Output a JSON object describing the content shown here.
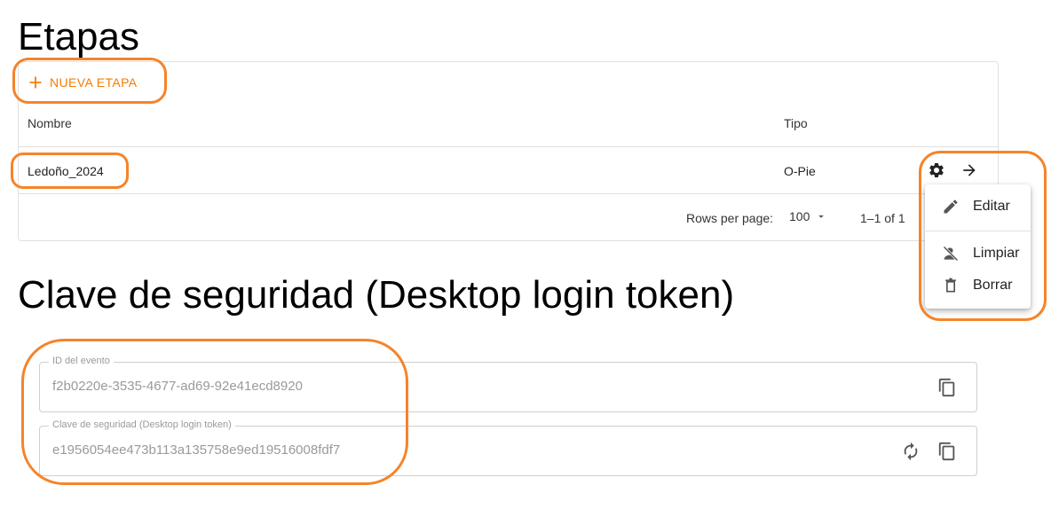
{
  "stages": {
    "title": "Etapas",
    "new_button_label": "NUEVA ETAPA",
    "columns": {
      "name": "Nombre",
      "type": "Tipo"
    },
    "rows": [
      {
        "name": "Ledoño_2024",
        "type": "O-Pie"
      }
    ],
    "pagination": {
      "rows_per_page_label": "Rows per page:",
      "rows_per_page_value": "100",
      "range": "1–1 of 1"
    },
    "row_menu": {
      "items": [
        {
          "label": "Editar",
          "icon": "pencil-icon"
        },
        {
          "label": "Limpiar",
          "icon": "person-off-icon"
        },
        {
          "label": "Borrar",
          "icon": "trash-icon"
        }
      ]
    }
  },
  "security": {
    "title": "Clave de seguridad (Desktop login token)",
    "event_id_label": "ID del evento",
    "event_id_value": "f2b0220e-3535-4677-ad69-92e41ecd8920",
    "token_label": "Clave de seguridad (Desktop login token)",
    "token_value": "e1956054ee473b113a135758e9ed19516008fdf7"
  },
  "colors": {
    "accent": "#f57c00",
    "annotation": "#f5842a"
  }
}
